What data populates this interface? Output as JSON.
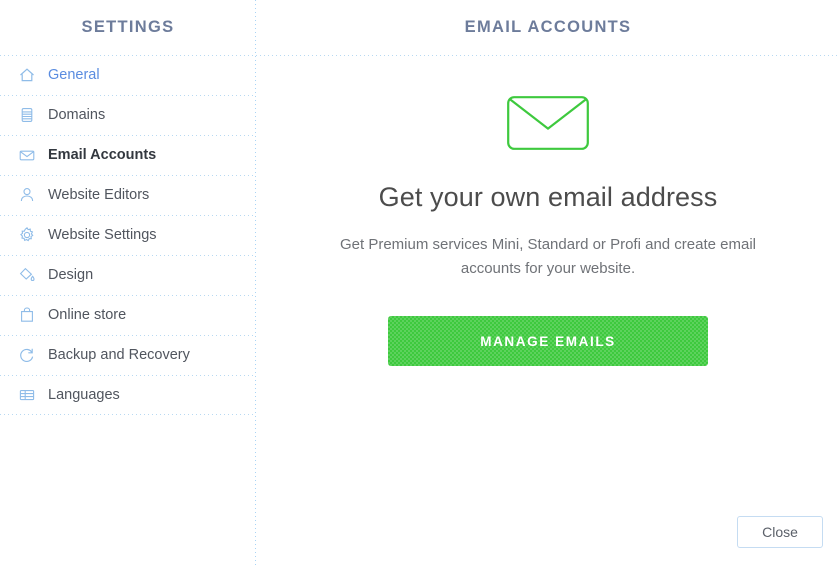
{
  "sidebar": {
    "title": "SETTINGS",
    "items": [
      {
        "label": "General",
        "icon": "home-icon",
        "state": "link"
      },
      {
        "label": "Domains",
        "icon": "database-icon",
        "state": "normal"
      },
      {
        "label": "Email Accounts",
        "icon": "envelope-icon",
        "state": "active"
      },
      {
        "label": "Website Editors",
        "icon": "user-icon",
        "state": "normal"
      },
      {
        "label": "Website Settings",
        "icon": "gear-icon",
        "state": "normal"
      },
      {
        "label": "Design",
        "icon": "paint-bucket-icon",
        "state": "normal"
      },
      {
        "label": "Online store",
        "icon": "shopping-bag-icon",
        "state": "normal"
      },
      {
        "label": "Backup and Recovery",
        "icon": "refresh-icon",
        "state": "normal"
      },
      {
        "label": "Languages",
        "icon": "table-icon",
        "state": "normal"
      }
    ]
  },
  "main": {
    "title": "EMAIL ACCOUNTS",
    "empty_state": {
      "icon": "envelope-outline-icon",
      "heading": "Get your own email address",
      "description": "Get Premium services Mini, Standard or Profi and create email accounts for your website.",
      "cta_label": "MANAGE EMAILS"
    },
    "close_label": "Close"
  },
  "colors": {
    "accent_green": "#3ec93e",
    "header_text": "#6d7c9b",
    "link_blue": "#5a8ce0",
    "icon_blue": "#8fbce8",
    "divider": "#b8d9f2"
  }
}
